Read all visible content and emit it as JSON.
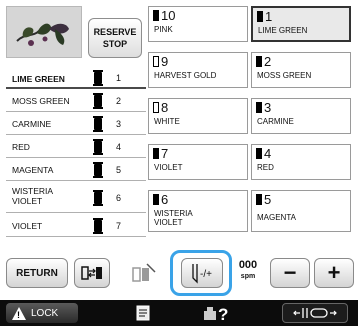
{
  "reserve_stop": {
    "line1": "RESERVE",
    "line2": "STOP"
  },
  "left_colors": [
    {
      "name": "LIME GREEN",
      "num": "1"
    },
    {
      "name": "MOSS GREEN",
      "num": "2"
    },
    {
      "name": "CARMINE",
      "num": "3"
    },
    {
      "name": "RED",
      "num": "4"
    },
    {
      "name": "MAGENTA",
      "num": "5"
    },
    {
      "name": "WISTERIA VIOLET",
      "num": "6"
    },
    {
      "name": "VIOLET",
      "num": "7"
    }
  ],
  "spools": [
    {
      "num": "10",
      "name": "PINK",
      "spool": "filled"
    },
    {
      "num": "1",
      "name": "LIME GREEN",
      "spool": "filled"
    },
    {
      "num": "9",
      "name": "HARVEST GOLD",
      "spool": "outline"
    },
    {
      "num": "2",
      "name": "MOSS GREEN",
      "spool": "filled"
    },
    {
      "num": "8",
      "name": "WHITE",
      "spool": "outline"
    },
    {
      "num": "3",
      "name": "CARMINE",
      "spool": "filled"
    },
    {
      "num": "7",
      "name": "VIOLET",
      "spool": "filled"
    },
    {
      "num": "4",
      "name": "RED",
      "spool": "filled"
    },
    {
      "num": "6",
      "name": "WISTERIA VIOLET",
      "spool": "filled"
    },
    {
      "num": "5",
      "name": "MAGENTA",
      "spool": "filled"
    }
  ],
  "toolbar": {
    "return_label": "RETURN",
    "speed_value": "000",
    "speed_unit": "spm",
    "minus_label": "−",
    "plus_label": "+"
  },
  "status_bar": {
    "lock_label": "LOCK"
  },
  "colors": {
    "highlight": "#3aa3e8",
    "status_bar": "#0c0c0c"
  }
}
